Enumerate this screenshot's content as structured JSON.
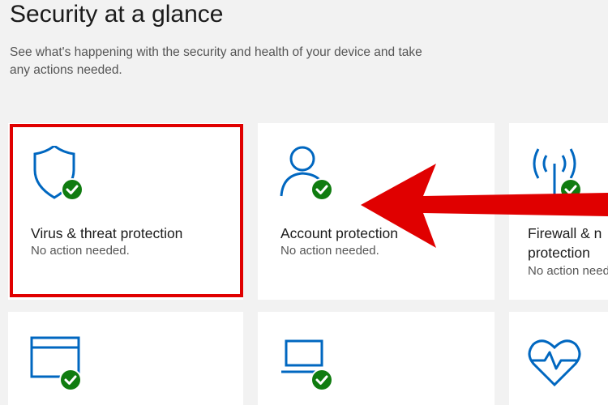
{
  "header": {
    "title": "Security at a glance",
    "subtitle": "See what's happening with the security and health of your device and take any actions needed."
  },
  "cards": [
    {
      "title": "Virus & threat protection",
      "status": "No action needed.",
      "icon": "shield-check-icon"
    },
    {
      "title": "Account protection",
      "status": "No action needed.",
      "icon": "person-check-icon"
    },
    {
      "title": "Firewall & n protection",
      "status": "No action needed.",
      "icon": "antenna-check-icon"
    },
    {
      "title": "",
      "status": "",
      "icon": "browser-window-check-icon"
    },
    {
      "title": "",
      "status": "",
      "icon": "laptop-check-icon"
    },
    {
      "title": "",
      "status": "",
      "icon": "heart-pulse-icon"
    }
  ],
  "colors": {
    "accent": "#0067c0",
    "check": "#107c10",
    "highlight": "#e00000"
  }
}
